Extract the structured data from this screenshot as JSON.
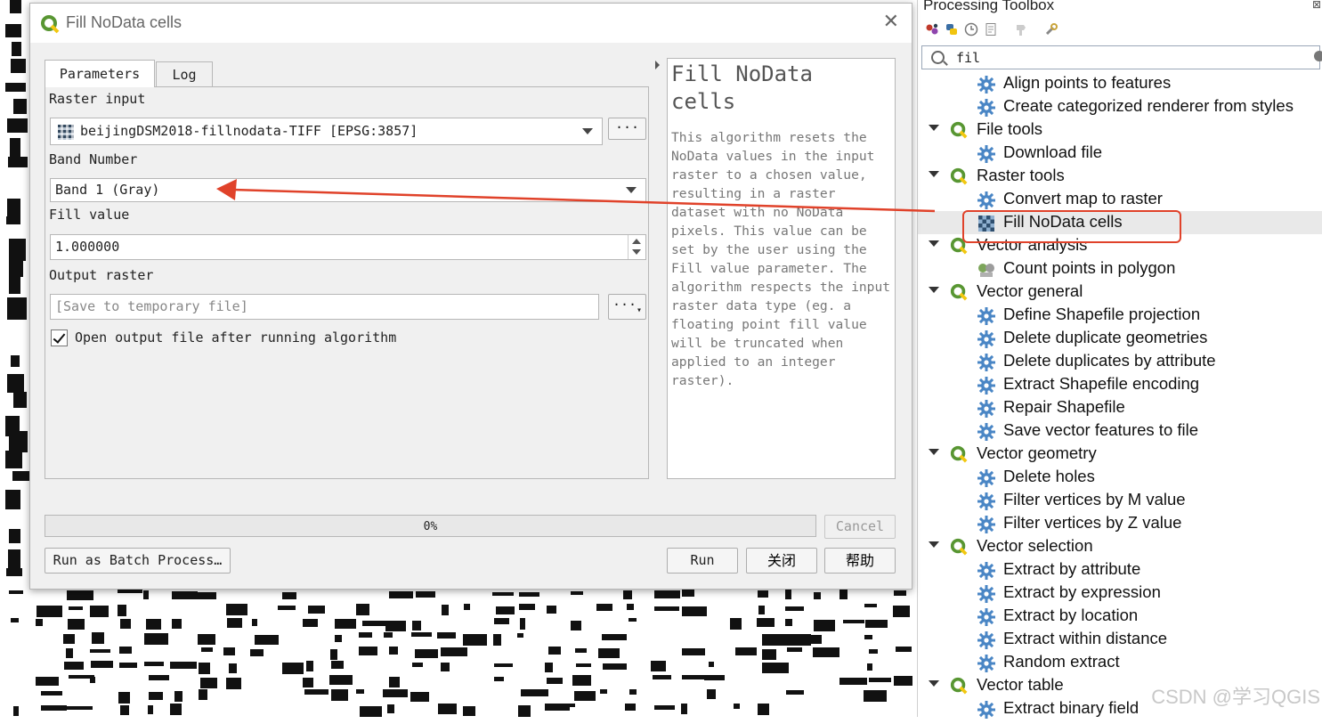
{
  "dialog": {
    "title": "Fill NoData cells",
    "tabs": [
      {
        "label": "Parameters"
      },
      {
        "label": "Log"
      }
    ],
    "raster_input": {
      "label": "Raster input",
      "value": "beijingDSM2018-fillnodata-TIFF [EPSG:3857]",
      "browse_label": "···"
    },
    "band_number": {
      "label": "Band Number",
      "value": "Band 1 (Gray)"
    },
    "fill_value": {
      "label": "Fill value",
      "value": "1.000000"
    },
    "output_raster": {
      "label": "Output raster",
      "placeholder": "[Save to temporary file]",
      "browse_label": "···"
    },
    "open_output": {
      "label": "Open output file after running algorithm",
      "checked": true
    },
    "help": {
      "title": "Fill NoData cells",
      "text": "This algorithm resets the NoData values in the input raster to a chosen value, resulting in a raster dataset with no NoData pixels. This value can be set by the user using the Fill value parameter. The algorithm respects the input raster data type (eg. a floating point fill value will be truncated when applied to an integer raster)."
    },
    "progress": {
      "value": 0,
      "label": "0%"
    },
    "buttons": {
      "cancel": "Cancel",
      "batch": "Run as Batch Process…",
      "run": "Run",
      "close": "关闭",
      "help": "帮助"
    }
  },
  "toolbox": {
    "title": "Processing Toolbox",
    "search_value": "fil",
    "tree": [
      {
        "type": "item",
        "label": "Align points to features",
        "icon": "gear-icon"
      },
      {
        "type": "item",
        "label": "Create categorized renderer from styles",
        "icon": "gear-icon"
      },
      {
        "type": "group",
        "label": "File tools"
      },
      {
        "type": "item",
        "label": "Download file",
        "icon": "gear-icon"
      },
      {
        "type": "group",
        "label": "Raster tools"
      },
      {
        "type": "item",
        "label": "Convert map to raster",
        "icon": "gear-icon"
      },
      {
        "type": "item",
        "label": "Fill NoData cells",
        "icon": "raster-icon",
        "selected": true
      },
      {
        "type": "group",
        "label": "Vector analysis"
      },
      {
        "type": "item",
        "label": "Count points in polygon",
        "icon": "vector-icon"
      },
      {
        "type": "group",
        "label": "Vector general"
      },
      {
        "type": "item",
        "label": "Define Shapefile projection",
        "icon": "gear-icon"
      },
      {
        "type": "item",
        "label": "Delete duplicate geometries",
        "icon": "gear-icon"
      },
      {
        "type": "item",
        "label": "Delete duplicates by attribute",
        "icon": "gear-icon"
      },
      {
        "type": "item",
        "label": "Extract Shapefile encoding",
        "icon": "gear-icon"
      },
      {
        "type": "item",
        "label": "Repair Shapefile",
        "icon": "gear-icon"
      },
      {
        "type": "item",
        "label": "Save vector features to file",
        "icon": "gear-icon"
      },
      {
        "type": "group",
        "label": "Vector geometry"
      },
      {
        "type": "item",
        "label": "Delete holes",
        "icon": "gear-icon"
      },
      {
        "type": "item",
        "label": "Filter vertices by M value",
        "icon": "gear-icon"
      },
      {
        "type": "item",
        "label": "Filter vertices by Z value",
        "icon": "gear-icon"
      },
      {
        "type": "group",
        "label": "Vector selection"
      },
      {
        "type": "item",
        "label": "Extract by attribute",
        "icon": "gear-icon"
      },
      {
        "type": "item",
        "label": "Extract by expression",
        "icon": "gear-icon"
      },
      {
        "type": "item",
        "label": "Extract by location",
        "icon": "gear-icon"
      },
      {
        "type": "item",
        "label": "Extract within distance",
        "icon": "gear-icon"
      },
      {
        "type": "item",
        "label": "Random extract",
        "icon": "gear-icon"
      },
      {
        "type": "group",
        "label": "Vector table"
      },
      {
        "type": "item",
        "label": "Extract binary field",
        "icon": "gear-icon"
      }
    ]
  },
  "watermark": "CSDN @学习QGIS",
  "colors": {
    "annotation": "#e0422a",
    "qgis_green": "#589632",
    "gear_blue": "#4a86c5"
  }
}
